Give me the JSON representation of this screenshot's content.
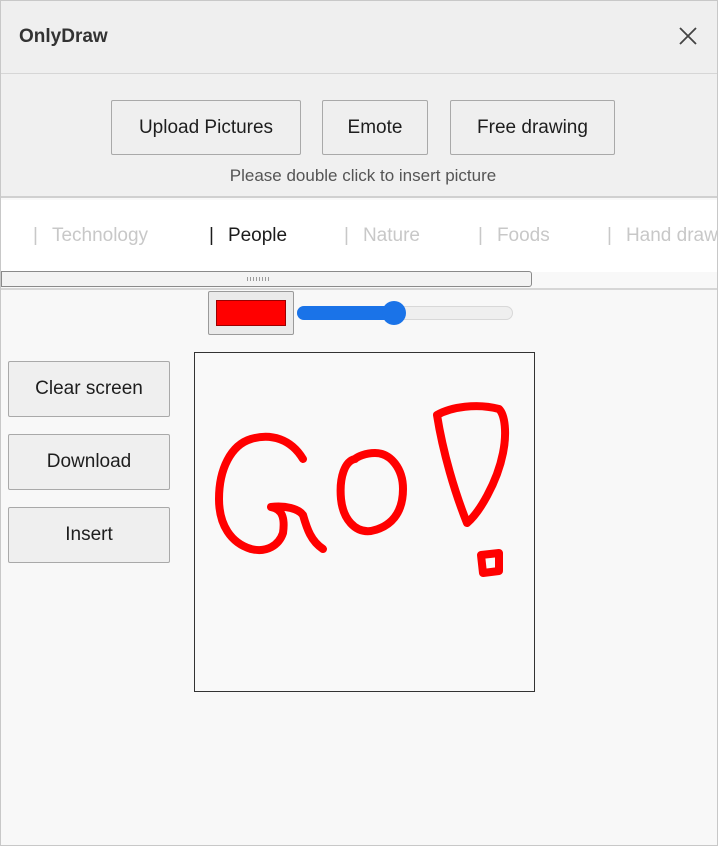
{
  "window": {
    "title": "OnlyDraw"
  },
  "toolbar": {
    "buttons": [
      "Upload Pictures",
      "Emote",
      "Free drawing"
    ],
    "hint": "Please double click to insert picture"
  },
  "tabs": {
    "separator": "|",
    "items": [
      "Technology",
      "People",
      "Nature",
      "Foods",
      "Hand draw"
    ],
    "active": "People"
  },
  "pen": {
    "color": "#ff0000",
    "size_fraction": 0.45
  },
  "side_buttons": {
    "clear": "Clear screen",
    "download": "Download",
    "insert": "Insert"
  },
  "accent_color": "#1a73e8"
}
